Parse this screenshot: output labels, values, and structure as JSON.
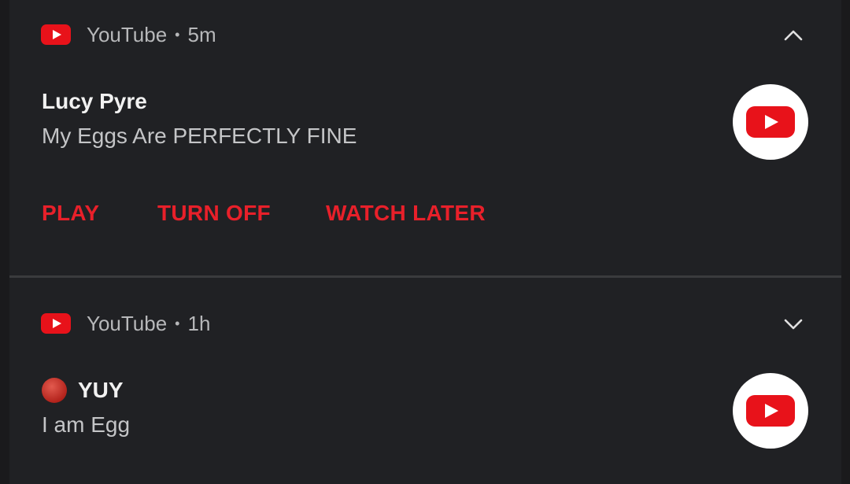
{
  "notifications": [
    {
      "app_name": "YouTube",
      "separator": "•",
      "time": "5m",
      "expanded": true,
      "chevron": "chevron-up-icon",
      "title": "Lucy Pyre",
      "body": "My Eggs Are PERFECTLY FINE",
      "actions": [
        "PLAY",
        "TURN OFF",
        "WATCH LATER"
      ],
      "large_icon": "youtube-logo-icon"
    },
    {
      "app_name": "YouTube",
      "separator": "•",
      "time": "1h",
      "expanded": false,
      "chevron": "chevron-down-icon",
      "title_emoji": "red-circle-emoji",
      "title": "YUY",
      "body": "I am Egg",
      "large_icon": "youtube-logo-icon"
    }
  ],
  "colors": {
    "background": "#202124",
    "action": "#e8202a",
    "youtube_red": "#e8121a"
  }
}
